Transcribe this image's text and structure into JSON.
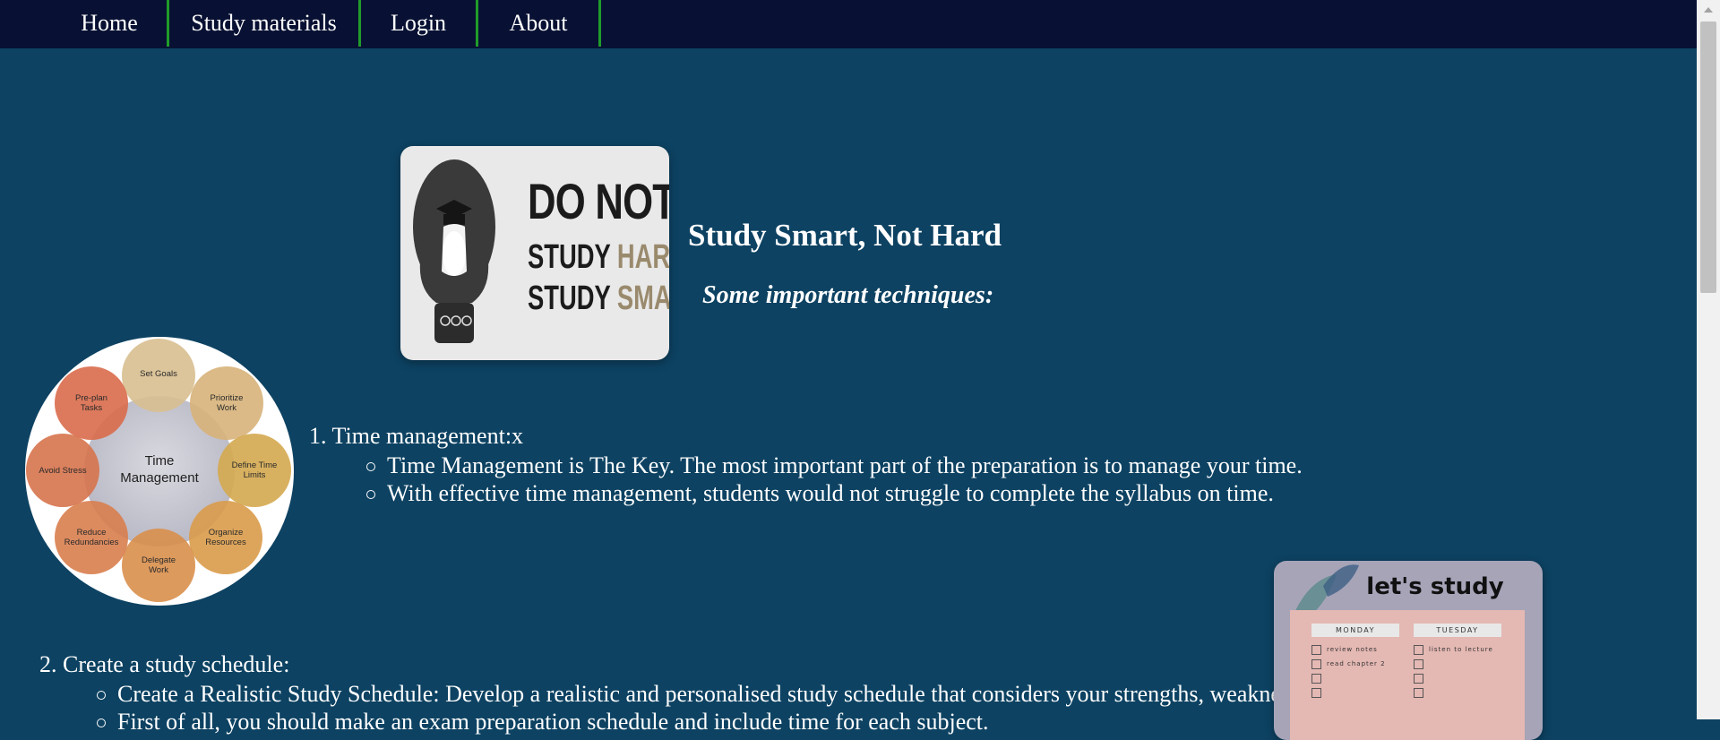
{
  "nav": {
    "items": [
      {
        "label": "Home"
      },
      {
        "label": "Study materials"
      },
      {
        "label": "Login"
      },
      {
        "label": "About"
      }
    ]
  },
  "hero": {
    "poster": {
      "line1": "DO NOT",
      "line2a": "STUDY",
      "line2b": "HARD,",
      "line3a": "STUDY",
      "line3b": "SMART."
    },
    "title": "Study Smart, Not Hard",
    "subtitle": "Some important techniques:"
  },
  "diagram": {
    "center": [
      "Time",
      "Management"
    ],
    "nodes": [
      {
        "lines": [
          "Set Goals"
        ]
      },
      {
        "lines": [
          "Prioritize",
          "Work"
        ]
      },
      {
        "lines": [
          "Define Time",
          "Limits"
        ]
      },
      {
        "lines": [
          "Organize",
          "Resources"
        ]
      },
      {
        "lines": [
          "Delegate",
          "Work"
        ]
      },
      {
        "lines": [
          "Reduce",
          "Redundancies"
        ]
      },
      {
        "lines": [
          "Avoid Stress"
        ]
      },
      {
        "lines": [
          "Pre-plan",
          "Tasks"
        ]
      }
    ]
  },
  "sections": [
    {
      "heading": "1. Time management:x",
      "bullets": [
        "Time Management is The Key. The most important part of the preparation is to manage your time.",
        "With effective time management, students would not struggle to complete the syllabus on time."
      ]
    },
    {
      "heading": "2. Create a study schedule:",
      "bullets": [
        "Create a Realistic Study Schedule: Develop a realistic and personalised study schedule that considers your strengths, weaknesses and available time.",
        "First of all, you should make an exam preparation schedule and include time for each subject."
      ]
    }
  ],
  "planner": {
    "title": "let's study",
    "days": [
      {
        "name": "MONDAY",
        "tasks": [
          "review notes",
          "read chapter 2"
        ]
      },
      {
        "name": "TUESDAY",
        "tasks": [
          "listen to lecture"
        ]
      }
    ]
  },
  "colors": {
    "background": "#0d4262",
    "navbar": "#081133",
    "nav_divider": "#1f9c2a"
  }
}
